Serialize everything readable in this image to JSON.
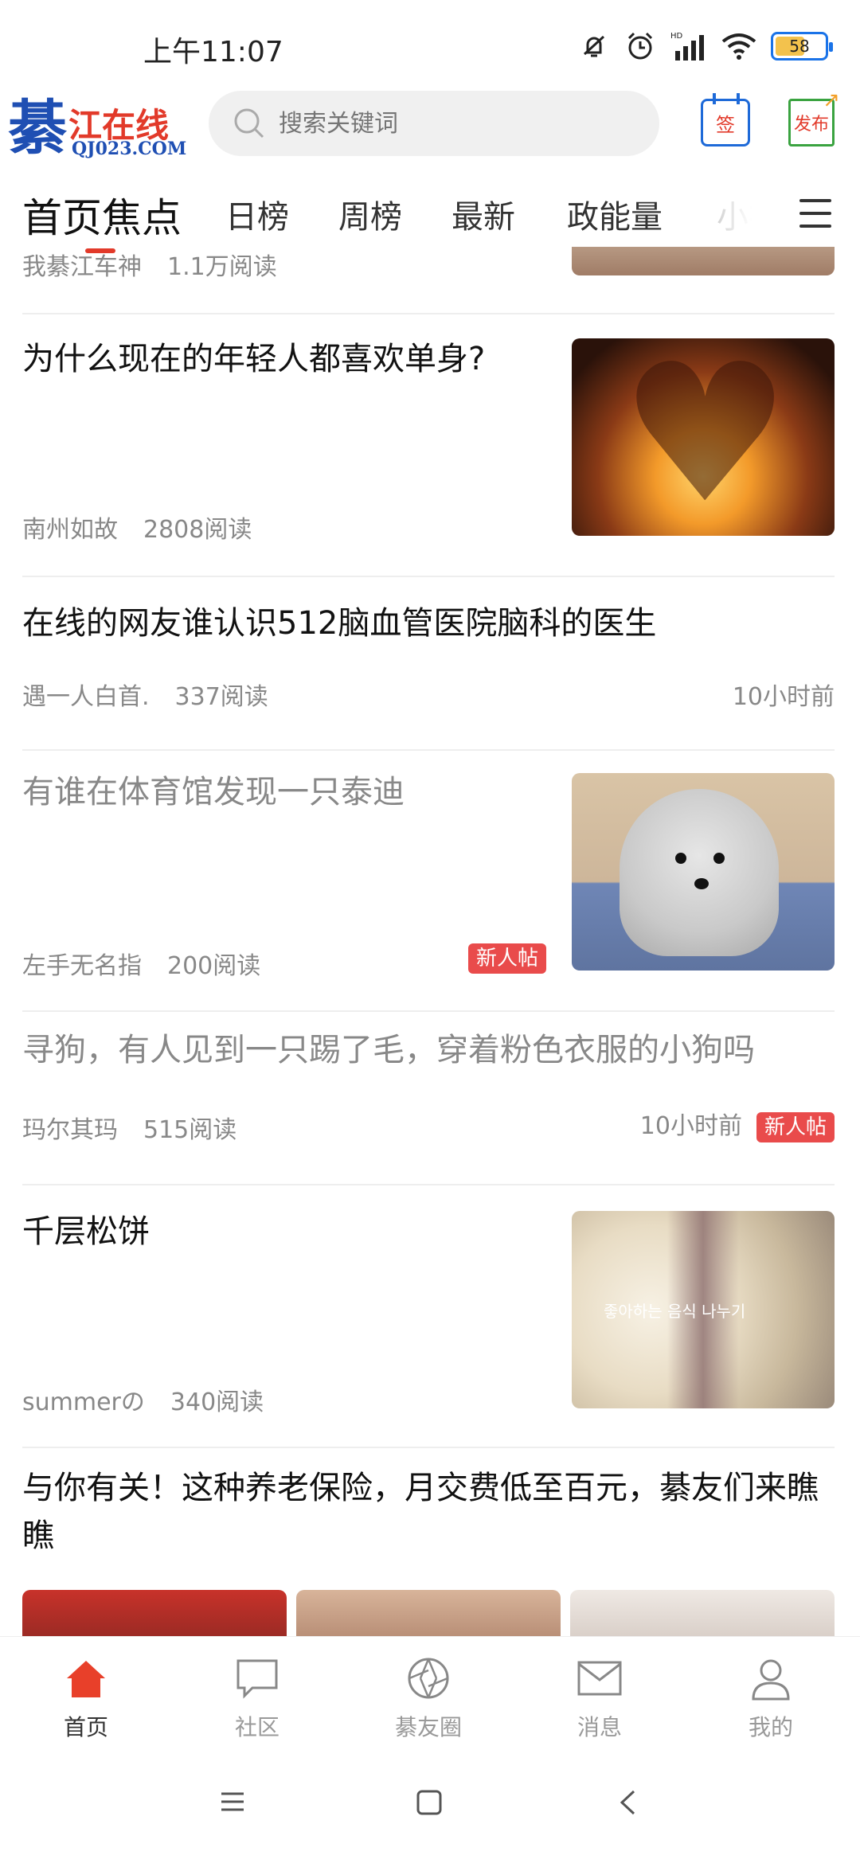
{
  "status_bar": {
    "time": "上午11:07",
    "battery": "58",
    "hd_label": "HD"
  },
  "header": {
    "logo_big": "綦",
    "logo_name": "江在线",
    "logo_url": "QJ023.COM",
    "search_placeholder": "搜索关键词",
    "sign_label": "签",
    "publish_label": "发布"
  },
  "tabs": [
    {
      "label": "首页焦点",
      "active": true
    },
    {
      "label": "日榜"
    },
    {
      "label": "周榜"
    },
    {
      "label": "最新"
    },
    {
      "label": "政能量"
    },
    {
      "label": "小视"
    }
  ],
  "feed": {
    "partial": {
      "author": "我綦江车神",
      "reads": "1.1万阅读"
    },
    "items": [
      {
        "title": "为什么现在的年轻人都喜欢单身?",
        "author": "南州如故",
        "reads": "2808阅读"
      },
      {
        "title": "在线的网友谁认识512脑血管医院脑科的医生",
        "author": "遇一人白首.",
        "reads": "337阅读",
        "time": "10小时前"
      },
      {
        "title": "有谁在体育馆发现一只泰迪",
        "author": "左手无名指",
        "reads": "200阅读",
        "badge": "新人帖"
      },
      {
        "title": "寻狗，有人见到一只踢了毛，穿着粉色衣服的小狗吗",
        "author": "玛尔其玛",
        "reads": "515阅读",
        "time": "10小时前",
        "badge": "新人帖"
      },
      {
        "title": "千层松饼",
        "author": "summerの",
        "reads": "340阅读",
        "image_caption": "좋아하는 음식 나누기"
      },
      {
        "title": "与你有关！这种养老保险，月交费低至百元，綦友们来瞧瞧"
      }
    ]
  },
  "bottom_nav": [
    {
      "label": "首页",
      "icon": "home-icon",
      "active": true
    },
    {
      "label": "社区",
      "icon": "chat-bubble-icon"
    },
    {
      "label": "綦友圈",
      "icon": "aperture-icon"
    },
    {
      "label": "消息",
      "icon": "mail-icon"
    },
    {
      "label": "我的",
      "icon": "user-icon"
    }
  ],
  "colors": {
    "accent": "#e23a2a",
    "brand_blue": "#1f4fb3",
    "badge_bg": "#e94b4b",
    "muted_text": "#888888"
  }
}
